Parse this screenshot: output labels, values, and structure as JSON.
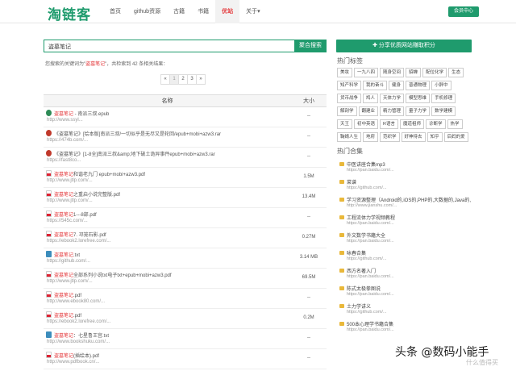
{
  "header": {
    "logo": "淘链客",
    "nav": [
      "首页",
      "github资源",
      "古籍",
      "书籍",
      "优站",
      "关于▾"
    ],
    "user_button": "会员中心"
  },
  "search": {
    "value": "盗墓笔记",
    "button": "聚合搜索"
  },
  "result_info": {
    "prefix": "您搜索的关键词为\"",
    "keyword": "盗墓笔记",
    "suffix": "\"，共检索到 42 条相关结果："
  },
  "pager": [
    "«",
    "1",
    "2",
    "3",
    "»"
  ],
  "table": {
    "col_name": "名称",
    "col_size": "大小",
    "rows": [
      {
        "icon": "epub",
        "hl": "盗墓笔记",
        "title": " - 南派三叔.epub",
        "url": "http://www.ssyl...",
        "size": "--"
      },
      {
        "icon": "rar",
        "hl": "",
        "title": "《盗墓笔记》[绘本版]南派三叔/一切似乎是无尽又是轮回/epub+mobi+azw3.rar",
        "url": "https://474b.com/...",
        "size": "--"
      },
      {
        "icon": "rar",
        "hl": "",
        "title": "《盗墓笔记》[1-8全]南派三叔&amp;地下破土诡异事件epub+mobi+azw3.rar",
        "url": "https://fast8co...",
        "size": "--"
      },
      {
        "icon": "pdf",
        "hl": "盗墓笔记",
        "title": "和谐老九门 epub+mobi+azw3.pdf",
        "url": "http://www.jtlp.com/...",
        "size": "1.5M"
      },
      {
        "icon": "pdf",
        "hl": "盗墓笔记",
        "title": "之重启小说完整版.pdf",
        "url": "http://www.jtlp.com/...",
        "size": "13.4M"
      },
      {
        "icon": "pdf",
        "hl": "盗墓笔记",
        "title": "1---8部.pdf",
        "url": "https://545c.com/...",
        "size": "--"
      },
      {
        "icon": "pdf",
        "hl": "盗墓笔记",
        "title": "7. 邛笼石影.pdf",
        "url": "https://ebook2.lorefree.com/...",
        "size": "0.27M"
      },
      {
        "icon": "txt",
        "hl": "盗墓笔记",
        "title": ".txt",
        "url": "https://github.com/...",
        "size": "3.14 MB"
      },
      {
        "icon": "pdf",
        "hl": "盗墓笔记",
        "title": "全部系列小说txt电子txt+epub+mobi+azw3.pdf",
        "url": "http://www.jtlp.com/...",
        "size": "69.5M"
      },
      {
        "icon": "pdf",
        "hl": "盗墓笔记",
        "title": ".pdf",
        "url": "http://www.ebook80.com/...",
        "size": "--"
      },
      {
        "icon": "pdf",
        "hl": "盗墓笔记",
        "title": ".pdf",
        "url": "https://ebook2.lorefree.com/...",
        "size": "0.2M"
      },
      {
        "icon": "txt",
        "hl": "盗墓笔记",
        "title": "：七星鲁王宫.txt",
        "url": "http://www.bookshuku.com/...",
        "size": "--"
      },
      {
        "icon": "pdf",
        "hl": "盗墓笔记",
        "title": "(插绘本).pdf",
        "url": "http://www.pdfbook.cn/...",
        "size": "--"
      }
    ]
  },
  "sidebar": {
    "share_button": "✚ 分享优质网站赚取积分",
    "tags_title": "热门标签",
    "tags": [
      "美妆",
      "一九八四",
      "随身空间",
      "貂蝉",
      "配位化学",
      "生态",
      "知产科学",
      "我的奋斗",
      "健身",
      "普通物理",
      "小胖中",
      "货币战争",
      "鸠人",
      "天体力学",
      "模型思维",
      "手机修理",
      "解剖学",
      "翻建业",
      "精力管理",
      "量子力学",
      "数学建模",
      "天王",
      "初中英语",
      "R语言",
      "魔道祖师",
      "诊断学",
      "热学",
      "鞠婧人生",
      "地府",
      "范织学",
      "好神待去",
      "知乎",
      "后妈的爱"
    ],
    "coll_title": "热门合集",
    "collections": [
      {
        "title": "中医讲座合集mp3",
        "url": "https://pan.baidu.com/..."
      },
      {
        "title": "菜谱",
        "url": "https://github.com/..."
      },
      {
        "title": "学习资源整理（Android的,iOS的,PHP的,大数据的,Java的,",
        "url": "http://www.jianshu.com/..."
      },
      {
        "title": "工程流体力学视频教程",
        "url": "https://pan.baidu.com/..."
      },
      {
        "title": "外文数学书籍大全",
        "url": "https://pan.baidu.com/..."
      },
      {
        "title": "咏春合集",
        "url": "https://github.com/..."
      },
      {
        "title": "西方名著入门",
        "url": "https://pan.baidu.com/..."
      },
      {
        "title": "陈式太极拳图说",
        "url": "https://pan.baidu.com/..."
      },
      {
        "title": "土力学讲义",
        "url": "https://github.com/..."
      },
      {
        "title": "500本心理学书籍合集",
        "url": "https://pan.baidu.com/..."
      }
    ]
  },
  "watermark": "头条 @数码小能手",
  "watermark2": "什么值得买",
  "colors": {
    "brand": "#1f9b6d",
    "highlight": "#e4393c"
  }
}
